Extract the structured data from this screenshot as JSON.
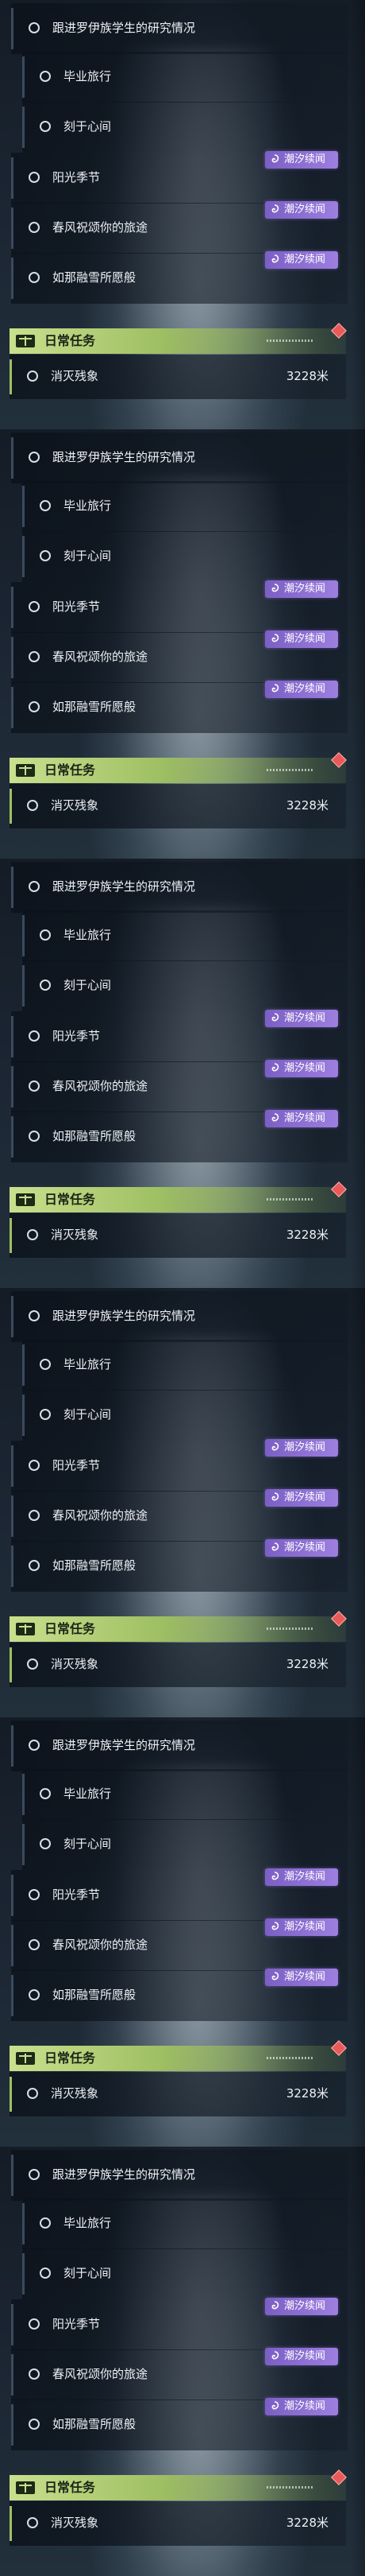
{
  "quest_list": {
    "items": [
      {
        "label": "跟进罗伊族学生的研究情况"
      },
      {
        "label": "毕业旅行"
      },
      {
        "label": "刻于心间"
      },
      {
        "label": "阳光季节",
        "badge": "潮汐续闻"
      },
      {
        "label": "春风祝颂你的旅途",
        "badge": "潮汐续闻"
      },
      {
        "label": "如那融雪所愿般",
        "badge": "潮汐续闻"
      }
    ]
  },
  "daily": {
    "title": "日常任务",
    "task_label": "消灭残象",
    "distance": "3228米"
  },
  "colors": {
    "accent_green": "#c9e08d",
    "badge_purple": "#9d7fe0",
    "marker_red": "#e85a5a"
  },
  "icons": {
    "section": "daily-task-book-icon",
    "badge": "tide-swirl-icon",
    "marker": "waypoint-diamond-icon"
  }
}
